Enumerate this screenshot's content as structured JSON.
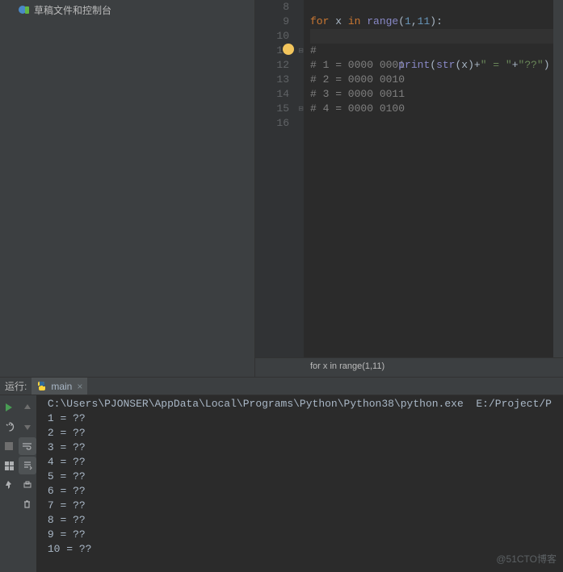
{
  "sidebar": {
    "item_label": "草稿文件和控制台"
  },
  "editor": {
    "line_numbers": [
      "8",
      "9",
      "10",
      "11",
      "12",
      "13",
      "14",
      "15",
      "16"
    ],
    "lines": {
      "l9_for": "for",
      "l9_x": " x ",
      "l9_in": "in",
      "l9_range": " range",
      "l9_p1": "(",
      "l9_n1": "1",
      "l9_c": ",",
      "l9_n2": "11",
      "l9_p2": "):",
      "l10_indent": "    ",
      "l10_print": "print",
      "l10_p1": "(",
      "l10_str": "str",
      "l10_p2": "(x)+",
      "l10_s1": "\" = \"",
      "l10_plus": "+",
      "l10_s2": "\"??\"",
      "l10_p3": ")",
      "l11": "#",
      "l12": "# 1 = 0000 0001",
      "l13": "# 2 = 0000 0010",
      "l14": "# 3 = 0000 0011",
      "l15": "# 4 = 0000 0100"
    },
    "breadcrumb": "for x in range(1,11)"
  },
  "run": {
    "label": "运行:",
    "tab_name": "main",
    "output": [
      "C:\\Users\\PJONSER\\AppData\\Local\\Programs\\Python\\Python38\\python.exe  E:/Project/P",
      "1 = ??",
      "2 = ??",
      "3 = ??",
      "4 = ??",
      "5 = ??",
      "6 = ??",
      "7 = ??",
      "8 = ??",
      "9 = ??",
      "10 = ??"
    ]
  },
  "watermark": "@51CTO博客"
}
